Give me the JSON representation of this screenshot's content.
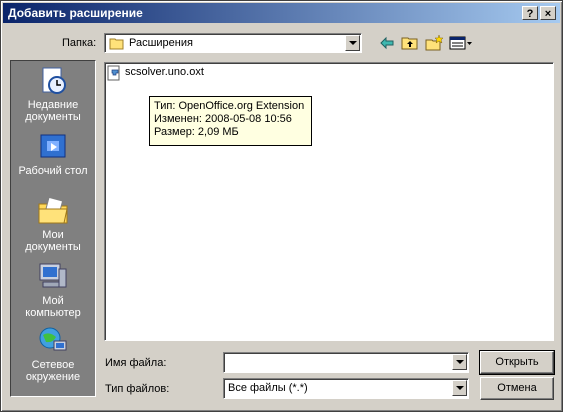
{
  "window": {
    "title": "Добавить расширение",
    "help_btn": "?",
    "close_btn": "×"
  },
  "toolbar": {
    "folder_label": "Папка:",
    "folder_value": "Расширения",
    "icons": [
      "back-arrow-icon",
      "up-folder-icon",
      "new-folder-icon",
      "view-menu-icon"
    ]
  },
  "places": [
    {
      "label": "Недавние\nдокументы",
      "icon": "recent-documents-icon"
    },
    {
      "label": "Рабочий стол",
      "icon": "desktop-icon"
    },
    {
      "label": "Мои\nдокументы",
      "icon": "my-documents-icon"
    },
    {
      "label": "Мой\nкомпьютер",
      "icon": "my-computer-icon"
    },
    {
      "label": "Сетевое\nокружение",
      "icon": "network-icon"
    }
  ],
  "files": [
    {
      "name": "scsolver.uno.oxt",
      "icon": "oxt-file-icon"
    }
  ],
  "tooltip": {
    "line1": "Тип: OpenOffice.org Extension",
    "line2": "Изменен: 2008-05-08 10:56",
    "line3": "Размер: 2,09 МБ"
  },
  "filename": {
    "label": "Имя файла:",
    "value": ""
  },
  "filetype": {
    "label": "Тип файлов:",
    "value": "Все файлы (*.*)"
  },
  "buttons": {
    "open": "Открыть",
    "cancel": "Отмена"
  },
  "colors": {
    "title_start": "#0a246a",
    "title_end": "#a6caf0",
    "face": "#d4d0c8",
    "places_bg": "#808080",
    "tooltip_bg": "#ffffe1"
  }
}
